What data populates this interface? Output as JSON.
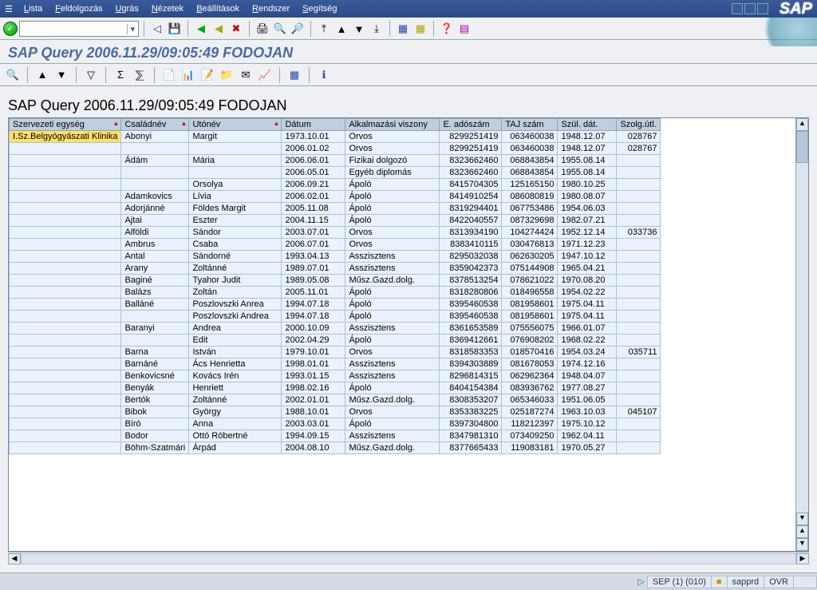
{
  "menu": {
    "items": [
      "Lista",
      "Feldolgozás",
      "Ugrás",
      "Nézetek",
      "Beállítások",
      "Rendszer",
      "Segítség"
    ]
  },
  "logo_text": "SAP",
  "page_title": "SAP Query 2006.11.29/09:05:49 FODOJAN",
  "alv_title": "SAP Query 2006.11.29/09:05:49 FODOJAN",
  "columns": [
    {
      "key": "org",
      "label": "Szervezeti egység",
      "class": "colOrg",
      "sort": true
    },
    {
      "key": "csalad",
      "label": "Családnév",
      "class": "colCsalad",
      "sort": true
    },
    {
      "key": "uto",
      "label": "Utónév",
      "class": "colUto",
      "sort": true
    },
    {
      "key": "datum",
      "label": "Dátum",
      "class": "colDatum"
    },
    {
      "key": "alk",
      "label": "Alkalmazási viszony",
      "class": "colAlk"
    },
    {
      "key": "ado",
      "label": "E. adószám",
      "class": "colAdo",
      "num": true
    },
    {
      "key": "taj",
      "label": "TAJ szám",
      "class": "colTaj",
      "num": true
    },
    {
      "key": "szul",
      "label": "Szül. dát.",
      "class": "colSzul"
    },
    {
      "key": "szolg",
      "label": "Szolg.útl.",
      "class": "colSzolg",
      "num": true
    }
  ],
  "rows": [
    {
      "org": "I.Sz.Belgyógyászati Klinika",
      "csalad": "Abonyi",
      "uto": "Margit",
      "datum": "1973.10.01",
      "alk": "Orvos",
      "ado": "8299251419",
      "taj": "063460038",
      "szul": "1948.12.07",
      "szolg": "028767",
      "hl": true
    },
    {
      "org": "",
      "csalad": "",
      "uto": "",
      "datum": "2006.01.02",
      "alk": "Orvos",
      "ado": "8299251419",
      "taj": "063460038",
      "szul": "1948.12.07",
      "szolg": "028767"
    },
    {
      "org": "",
      "csalad": "Ádám",
      "uto": "Mária",
      "datum": "2006.06.01",
      "alk": "Fizikai dolgozó",
      "ado": "8323662460",
      "taj": "068843854",
      "szul": "1955.08.14",
      "szolg": ""
    },
    {
      "org": "",
      "csalad": "",
      "uto": "",
      "datum": "2006.05.01",
      "alk": "Egyéb diplomás",
      "ado": "8323662460",
      "taj": "068843854",
      "szul": "1955.08.14",
      "szolg": ""
    },
    {
      "org": "",
      "csalad": "",
      "uto": "Orsolya",
      "datum": "2006.09.21",
      "alk": "Ápoló",
      "ado": "8415704305",
      "taj": "125165150",
      "szul": "1980.10.25",
      "szolg": ""
    },
    {
      "org": "",
      "csalad": "Adamkovics",
      "uto": "Lívia",
      "datum": "2006.02.01",
      "alk": "Ápoló",
      "ado": "8414910254",
      "taj": "086080819",
      "szul": "1980.08.07",
      "szolg": ""
    },
    {
      "org": "",
      "csalad": "Adorjánné",
      "uto": "Földes Margit",
      "datum": "2005.11.08",
      "alk": "Ápoló",
      "ado": "8319294401",
      "taj": "067753486",
      "szul": "1954.06.03",
      "szolg": ""
    },
    {
      "org": "",
      "csalad": "Ajtai",
      "uto": "Eszter",
      "datum": "2004.11.15",
      "alk": "Ápoló",
      "ado": "8422040557",
      "taj": "087329698",
      "szul": "1982.07.21",
      "szolg": ""
    },
    {
      "org": "",
      "csalad": "Alföldi",
      "uto": "Sándor",
      "datum": "2003.07.01",
      "alk": "Orvos",
      "ado": "8313934190",
      "taj": "104274424",
      "szul": "1952.12.14",
      "szolg": "033736"
    },
    {
      "org": "",
      "csalad": "Ambrus",
      "uto": "Csaba",
      "datum": "2006.07.01",
      "alk": "Orvos",
      "ado": "8383410115",
      "taj": "030476813",
      "szul": "1971.12.23",
      "szolg": ""
    },
    {
      "org": "",
      "csalad": "Antal",
      "uto": "Sándorné",
      "datum": "1993.04.13",
      "alk": "Asszisztens",
      "ado": "8295032038",
      "taj": "062630205",
      "szul": "1947.10.12",
      "szolg": ""
    },
    {
      "org": "",
      "csalad": "Arany",
      "uto": "Zoltánné",
      "datum": "1989.07.01",
      "alk": "Asszisztens",
      "ado": "8359042373",
      "taj": "075144908",
      "szul": "1965.04.21",
      "szolg": ""
    },
    {
      "org": "",
      "csalad": "Baginé",
      "uto": "Tyahor Judit",
      "datum": "1989.05.08",
      "alk": "Műsz.Gazd.dolg.",
      "ado": "8378513254",
      "taj": "078621022",
      "szul": "1970.08.20",
      "szolg": ""
    },
    {
      "org": "",
      "csalad": "Balázs",
      "uto": "Zoltán",
      "datum": "2005.11.01",
      "alk": "Ápoló",
      "ado": "8318280806",
      "taj": "018496558",
      "szul": "1954.02.22",
      "szolg": ""
    },
    {
      "org": "",
      "csalad": "Balláné",
      "uto": "Poszlovszki  Anrea",
      "datum": "1994.07.18",
      "alk": "Ápoló",
      "ado": "8395460538",
      "taj": "081958601",
      "szul": "1975.04.11",
      "szolg": ""
    },
    {
      "org": "",
      "csalad": "",
      "uto": "Poszlovszki Andrea",
      "datum": "1994.07.18",
      "alk": "Ápoló",
      "ado": "8395460538",
      "taj": "081958601",
      "szul": "1975.04.11",
      "szolg": ""
    },
    {
      "org": "",
      "csalad": "Baranyi",
      "uto": "Andrea",
      "datum": "2000.10.09",
      "alk": "Asszisztens",
      "ado": "8361653589",
      "taj": "075556075",
      "szul": "1966.01.07",
      "szolg": ""
    },
    {
      "org": "",
      "csalad": "",
      "uto": "Edit",
      "datum": "2002.04.29",
      "alk": "Ápoló",
      "ado": "8369412661",
      "taj": "076908202",
      "szul": "1968.02.22",
      "szolg": ""
    },
    {
      "org": "",
      "csalad": "Barna",
      "uto": "István",
      "datum": "1979.10.01",
      "alk": "Orvos",
      "ado": "8318583353",
      "taj": "018570416",
      "szul": "1954.03.24",
      "szolg": "035711"
    },
    {
      "org": "",
      "csalad": "Barnáné",
      "uto": "Ács Henrietta",
      "datum": "1998.01.01",
      "alk": "Asszisztens",
      "ado": "8394303889",
      "taj": "081678053",
      "szul": "1974.12.16",
      "szolg": ""
    },
    {
      "org": "",
      "csalad": "Benkovicsné",
      "uto": "Kovács Irén",
      "datum": "1993.01.15",
      "alk": "Asszisztens",
      "ado": "8296814315",
      "taj": "062962364",
      "szul": "1948.04.07",
      "szolg": ""
    },
    {
      "org": "",
      "csalad": "Benyák",
      "uto": "Henriett",
      "datum": "1998.02.16",
      "alk": "Ápoló",
      "ado": "8404154384",
      "taj": "083936762",
      "szul": "1977.08.27",
      "szolg": ""
    },
    {
      "org": "",
      "csalad": "Bertók",
      "uto": "Zoltánné",
      "datum": "2002.01.01",
      "alk": "Műsz.Gazd.dolg.",
      "ado": "8308353207",
      "taj": "065346033",
      "szul": "1951.06.05",
      "szolg": ""
    },
    {
      "org": "",
      "csalad": "Bibok",
      "uto": "György",
      "datum": "1988.10.01",
      "alk": "Orvos",
      "ado": "8353383225",
      "taj": "025187274",
      "szul": "1963.10.03",
      "szolg": "045107"
    },
    {
      "org": "",
      "csalad": "Bíró",
      "uto": "Anna",
      "datum": "2003.03.01",
      "alk": "Ápoló",
      "ado": "8397304800",
      "taj": "118212397",
      "szul": "1975.10.12",
      "szolg": ""
    },
    {
      "org": "",
      "csalad": "Bodor",
      "uto": "Ottó Róbertné",
      "datum": "1994.09.15",
      "alk": "Asszisztens",
      "ado": "8347981310",
      "taj": "073409250",
      "szul": "1962.04.11",
      "szolg": ""
    },
    {
      "org": "",
      "csalad": "Böhm-Szatmári",
      "uto": "Árpád",
      "datum": "2004.08.10",
      "alk": "Műsz.Gazd.dolg.",
      "ado": "8377665433",
      "taj": "119083181",
      "szul": "1970.05.27",
      "szolg": ""
    }
  ],
  "status": {
    "arrow": "▷",
    "session": "SEP (1) (010)",
    "sys_icon": "■",
    "server": "sapprd",
    "mode": "OVR"
  }
}
